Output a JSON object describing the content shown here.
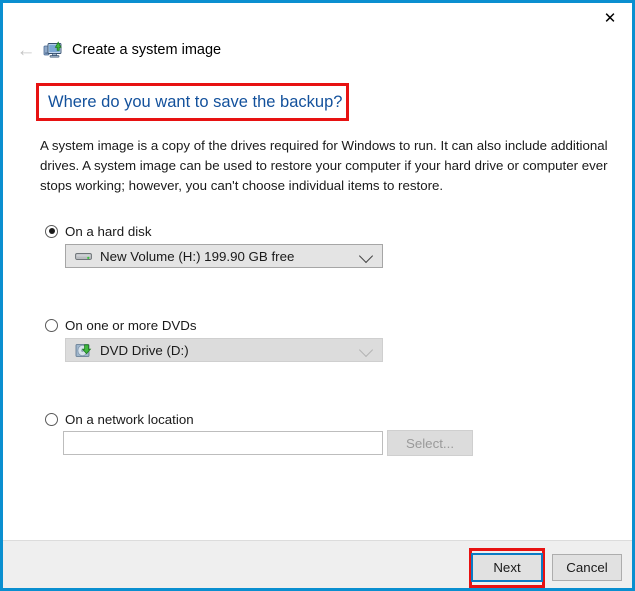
{
  "window": {
    "border_color": "#0a8fd0",
    "close_label": "✕",
    "back_label": "←",
    "app_icon_name": "computer-backup-icon",
    "app_title": "Create a system image"
  },
  "heading": {
    "text": "Where do you want to save the backup?",
    "color": "#13519c",
    "highlight_color": "#e71212"
  },
  "body": {
    "paragraph": "A system image is a copy of the drives required for Windows to run. It can also include additional drives. A system image can be used to restore your computer if your hard drive or computer ever stops working; however, you can't choose individual items to restore."
  },
  "options": [
    {
      "id": "hard-disk",
      "radio_label": "On a hard disk",
      "selected": true,
      "combo_icon": "hard-drive-icon",
      "combo_value": "New Volume (H:)  199.90 GB free",
      "enabled": true
    },
    {
      "id": "dvds",
      "radio_label": "On one or more DVDs",
      "selected": false,
      "combo_icon": "dvd-disc-icon",
      "combo_value": "DVD Drive (D:)",
      "enabled": false
    },
    {
      "id": "network",
      "radio_label": "On a network location",
      "selected": false,
      "input_value": "",
      "input_placeholder": "",
      "select_button_label": "Select...",
      "enabled": false
    }
  ],
  "footer": {
    "next_label": "Next",
    "cancel_label": "Cancel",
    "next_highlight_color": "#e71212"
  }
}
